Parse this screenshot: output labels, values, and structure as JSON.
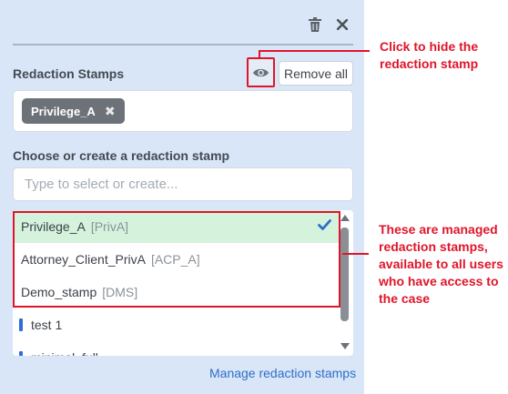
{
  "toolbar": {
    "delete_icon": "trash-icon",
    "close_icon": "close-icon"
  },
  "stamps_section": {
    "title": "Redaction Stamps",
    "remove_all_label": "Remove all",
    "selected_tags": [
      {
        "label": "Privilege_A"
      }
    ]
  },
  "chooser": {
    "title": "Choose or create a redaction stamp",
    "placeholder": "Type to select or create..."
  },
  "stamps_list": [
    {
      "name": "Privilege_A",
      "abbr": "[PrivA]",
      "managed": true,
      "selected": true
    },
    {
      "name": "Attorney_Client_PrivA",
      "abbr": "[ACP_A]",
      "managed": true,
      "selected": false
    },
    {
      "name": "Demo_stamp",
      "abbr": "[DMS]",
      "managed": true,
      "selected": false
    },
    {
      "name": "test 1",
      "abbr": "",
      "managed": false,
      "selected": false
    },
    {
      "name": "minimal_full",
      "abbr": "",
      "managed": false,
      "selected": false
    }
  ],
  "footer": {
    "manage_link": "Manage redaction stamps"
  },
  "annotations": {
    "hide_stamp": "Click to hide the redaction stamp",
    "managed_stamps": "These are managed redaction stamps, available to all users who have access to the case"
  },
  "colors": {
    "panel_bg": "#d9e6f7",
    "annotation_red": "#e0152a",
    "selected_row": "#d4f2dc",
    "link_blue": "#2f6fc9",
    "chip_gray": "#6d7278"
  }
}
